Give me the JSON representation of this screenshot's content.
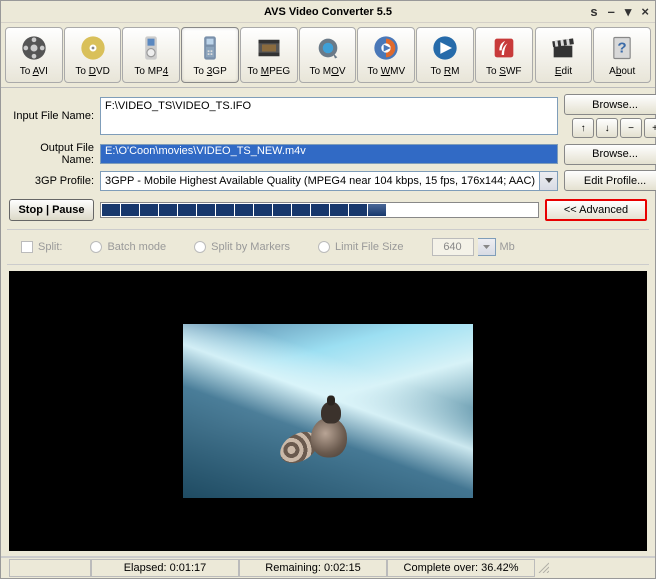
{
  "window": {
    "title": "AVS Video Converter 5.5"
  },
  "toolbar": {
    "avi": "To AVI",
    "dvd": "To DVD",
    "mp4": "To MP4",
    "3gp": "To 3GP",
    "mpeg": "To MPEG",
    "mov": "To MOV",
    "wmv": "To WMV",
    "rm": "To RM",
    "swf": "To SWF",
    "edit": "Edit",
    "about": "About"
  },
  "labels": {
    "input": "Input File Name:",
    "output": "Output File Name:",
    "profile": "3GP Profile:"
  },
  "inputs": {
    "input_file": "F:\\VIDEO_TS\\VIDEO_TS.IFO",
    "output_file": "E:\\O'Coon\\movies\\VIDEO_TS_NEW.m4v",
    "profile": "3GPP - Mobile Highest Available Quality (MPEG4  near 104 kbps, 15 fps, 176x144; AAC)"
  },
  "buttons": {
    "browse": "Browse...",
    "edit_profile": "Edit Profile...",
    "advanced": "<< Advanced",
    "stop_pause": "Stop | Pause"
  },
  "options": {
    "split": "Split:",
    "batch": "Batch mode",
    "split_markers": "Split by Markers",
    "limit_size": "Limit File Size",
    "size_value": "640",
    "size_unit": "Mb"
  },
  "status": {
    "elapsed_label": "Elapsed:",
    "elapsed": "0:01:17",
    "remaining_label": "Remaining:",
    "remaining": "0:02:15",
    "complete_label": "Complete over:",
    "complete": "36.42%"
  }
}
